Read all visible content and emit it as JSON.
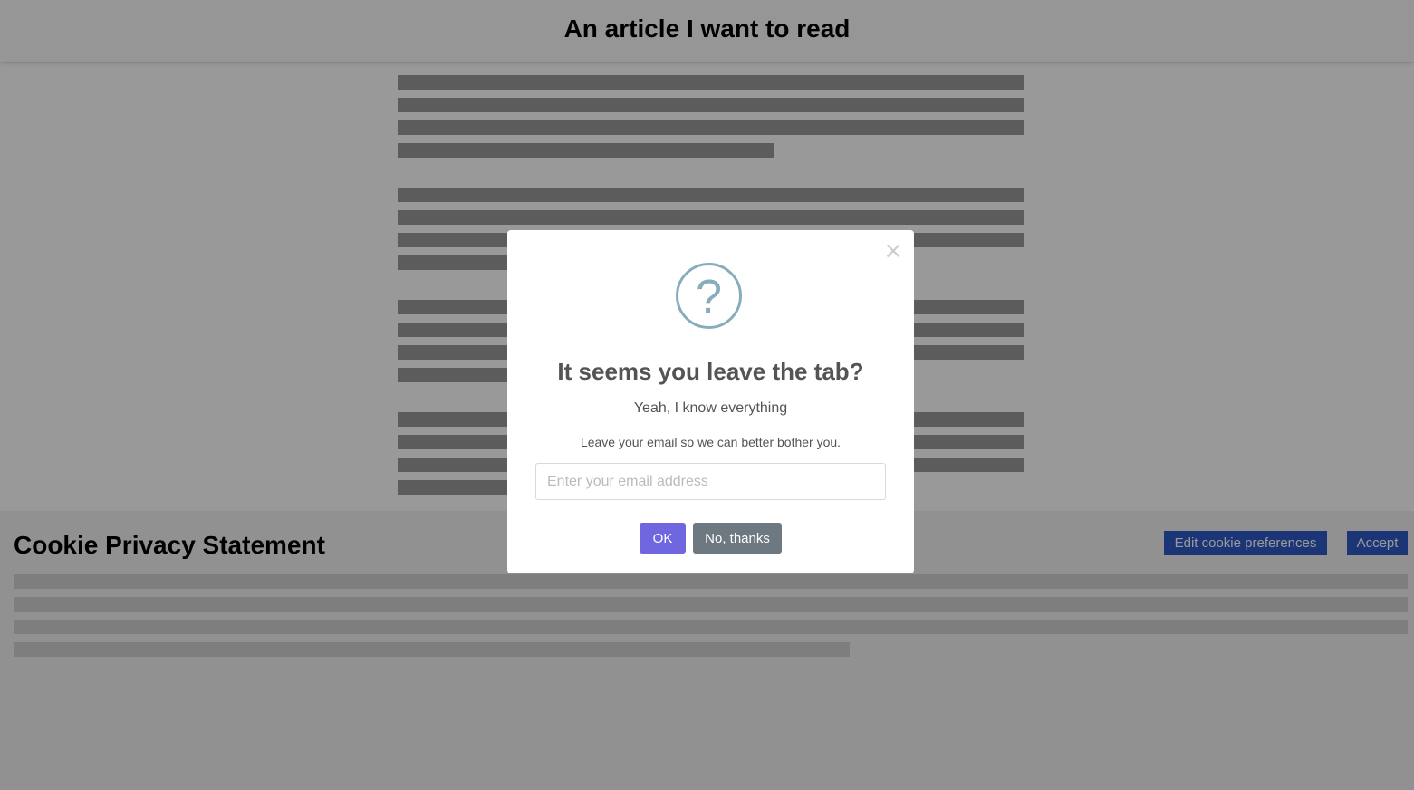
{
  "article": {
    "title": "An article I want to read"
  },
  "cookie_banner": {
    "title": "Cookie Privacy Statement",
    "edit_label": "Edit cookie preferences",
    "accept_label": "Accept"
  },
  "modal": {
    "close_glyph": "×",
    "icon_glyph": "?",
    "title": "It seems you leave the tab?",
    "subtitle": "Yeah, I know everything",
    "text": "Leave your email so we can better bother you.",
    "email_placeholder": "Enter your email address",
    "ok_label": "OK",
    "cancel_label": "No, thanks"
  },
  "colors": {
    "cookie_button": "#2f59c7",
    "ok_button": "#7066e0",
    "cancel_button": "#6e7881",
    "question_icon": "#87adbd"
  }
}
